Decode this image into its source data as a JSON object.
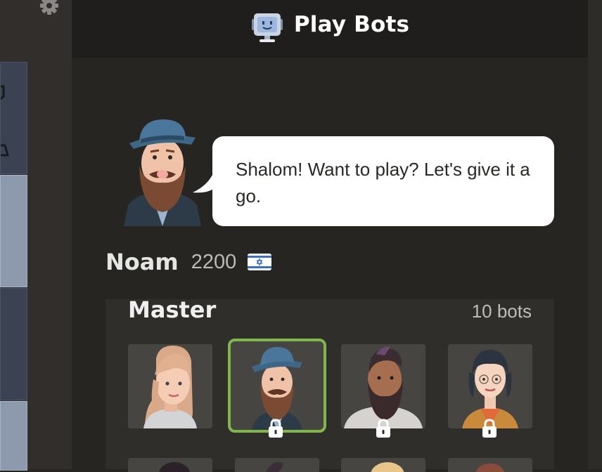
{
  "header": {
    "title": "Play Bots",
    "icon": "robot-monitor-icon"
  },
  "bot": {
    "name": "Noam",
    "rating": "2200",
    "country_flag": "israel-flag-icon",
    "greeting": "Shalom! Want to play? Let's give it a go."
  },
  "category": {
    "title": "Master",
    "count": "10 bots",
    "tiles": [
      {
        "name": "bot-avatar-woman-blonde",
        "locked": false,
        "selected": false
      },
      {
        "name": "bot-avatar-noam",
        "locked": true,
        "selected": true
      },
      {
        "name": "bot-avatar-bearded-man",
        "locked": true,
        "selected": false
      },
      {
        "name": "bot-avatar-woman-dark-hair",
        "locked": true,
        "selected": false
      }
    ]
  },
  "colors": {
    "background": "#262522",
    "header": "#1f1e1c",
    "panel": "#302e2b",
    "selected_border": "#81b64c"
  }
}
